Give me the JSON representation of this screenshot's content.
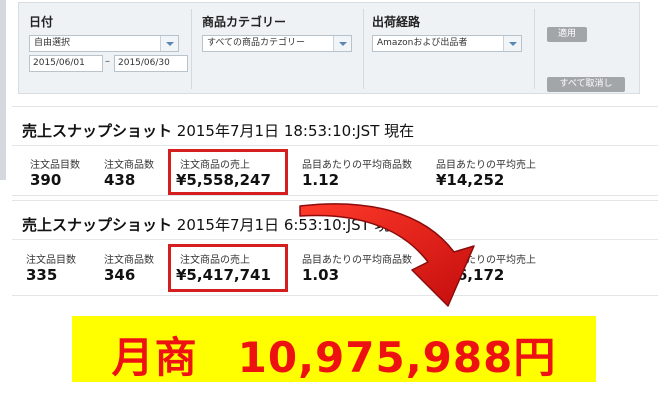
{
  "filters": {
    "date": {
      "label": "日付",
      "mode": "自由選択",
      "start": "2015/06/01",
      "separator": "–",
      "end": "2015/06/30"
    },
    "category": {
      "label": "商品カテゴリー",
      "selected": "すべての商品カテゴリー"
    },
    "fulfillment": {
      "label": "出荷経路",
      "selected": "Amazonおよび出品者"
    },
    "apply_label": "適用",
    "clear_label": "すべて取消し"
  },
  "snapshots": [
    {
      "title_prefix": "売上スナップショット",
      "title_time": "2015年7月1日 18:53:10:JST 現在",
      "metrics": [
        {
          "label": "注文品目数",
          "value": "390"
        },
        {
          "label": "注文商品数",
          "value": "438"
        },
        {
          "label": "注文商品の売上",
          "value": "¥5,558,247"
        },
        {
          "label": "品目あたりの平均商品数",
          "value": "1.12"
        },
        {
          "label": "品目あたりの平均売上",
          "value": "¥14,252"
        }
      ]
    },
    {
      "title_prefix": "売上スナップショット",
      "title_time": "2015年7月1日 6:53:10:JST 現在",
      "metrics": [
        {
          "label": "注文品目数",
          "value": "335"
        },
        {
          "label": "注文商品数",
          "value": "346"
        },
        {
          "label": "注文商品の売上",
          "value": "¥5,417,741"
        },
        {
          "label": "品目あたりの平均商品数",
          "value": "1.03"
        },
        {
          "label": "品目あたりの平均売上",
          "value": "¥16,172"
        }
      ]
    }
  ],
  "banner": {
    "label": "月商",
    "amount": "10,975,988円"
  },
  "colors": {
    "highlight_red": "#d51f1f",
    "banner_yellow": "#ffff00",
    "banner_text": "#ee1111"
  }
}
